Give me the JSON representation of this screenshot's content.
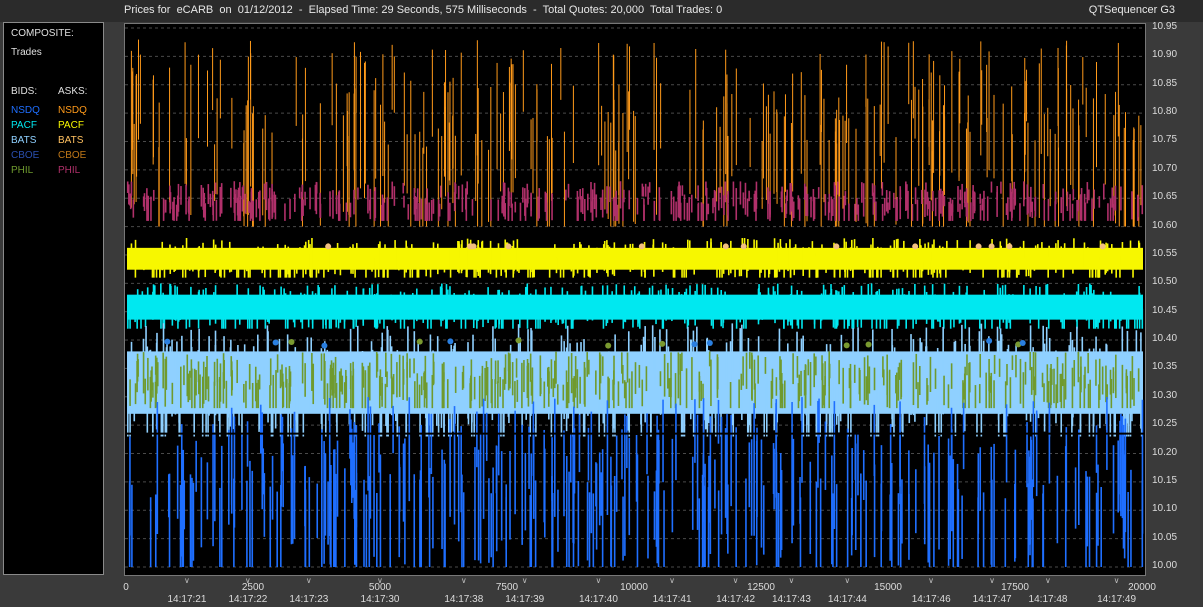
{
  "window": {
    "title": "Prices for  eCARB  on  01/12/2012  -  Elapsed Time: 29 Seconds, 575 Milliseconds  -  Total Quotes: 20,000  Total Trades: 0",
    "app_name": "QTSequencer G3"
  },
  "legend": {
    "composite_label": "COMPOSITE:",
    "trades_label": "Trades",
    "bids_header": "BIDS:",
    "asks_header": "ASKS:",
    "bids": [
      {
        "label": "NSDQ",
        "color": "#1f6fff"
      },
      {
        "label": "PACF",
        "color": "#00e8f0"
      },
      {
        "label": "BATS",
        "color": "#8fd0ff"
      },
      {
        "label": "CBOE",
        "color": "#2a4fb0"
      },
      {
        "label": "PHIL",
        "color": "#6f9a2e"
      }
    ],
    "asks": [
      {
        "label": "NSDQ",
        "color": "#ff9a1a"
      },
      {
        "label": "PACF",
        "color": "#f7f700"
      },
      {
        "label": "BATS",
        "color": "#ffc060"
      },
      {
        "label": "CBOE",
        "color": "#c07818"
      },
      {
        "label": "PHIL",
        "color": "#b0306a"
      }
    ]
  },
  "chart_data": {
    "type": "line",
    "ylim": [
      10.0,
      10.95
    ],
    "y_ticks": [
      "10.95",
      "10.90",
      "10.85",
      "10.80",
      "10.75",
      "10.70",
      "10.65",
      "10.60",
      "10.55",
      "10.50",
      "10.45",
      "10.40",
      "10.35",
      "10.30",
      "10.25",
      "10.20",
      "10.15",
      "10.10",
      "10.05",
      "10.00"
    ],
    "xlim": [
      0,
      20000
    ],
    "x_ticks": [
      "0",
      "2500",
      "5000",
      "7500",
      "10000",
      "12500",
      "15000",
      "17500",
      "20000"
    ],
    "time_ticks": [
      {
        "x": 1200,
        "label": "14:17:21"
      },
      {
        "x": 2400,
        "label": "14:17:22"
      },
      {
        "x": 3600,
        "label": "14:17:23"
      },
      {
        "x": 5000,
        "label": "14:17:30"
      },
      {
        "x": 6650,
        "label": "14:17:38"
      },
      {
        "x": 7850,
        "label": "14:17:39"
      },
      {
        "x": 9300,
        "label": "14:17:40"
      },
      {
        "x": 10750,
        "label": "14:17:41"
      },
      {
        "x": 12000,
        "label": "14:17:42"
      },
      {
        "x": 13100,
        "label": "14:17:43"
      },
      {
        "x": 14200,
        "label": "14:17:44"
      },
      {
        "x": 15850,
        "label": "14:17:46"
      },
      {
        "x": 17050,
        "label": "14:17:47"
      },
      {
        "x": 18150,
        "label": "14:17:48"
      },
      {
        "x": 19500,
        "label": "14:17:49"
      }
    ],
    "series": [
      {
        "name": "NSDQ ask",
        "color": "#ff9a1a",
        "band": [
          10.6,
          10.93
        ]
      },
      {
        "name": "PHIL ask",
        "color": "#b0306a",
        "band": [
          10.61,
          10.68
        ]
      },
      {
        "name": "PACF ask",
        "color": "#f7f700",
        "band": [
          10.51,
          10.58
        ]
      },
      {
        "name": "PACF bid",
        "color": "#00e8f0",
        "band": [
          10.42,
          10.5
        ]
      },
      {
        "name": "BATS bid",
        "color": "#8fd0ff",
        "band": [
          10.23,
          10.43
        ]
      },
      {
        "name": "PHIL bid",
        "color": "#6f9a2e",
        "band": [
          10.28,
          10.38
        ]
      },
      {
        "name": "NSDQ bid",
        "color": "#1f6fff",
        "band": [
          10.0,
          10.3
        ]
      }
    ]
  }
}
